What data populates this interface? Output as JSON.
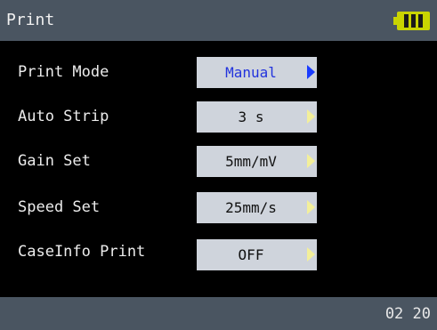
{
  "header": {
    "title": "Print",
    "battery_icon": "battery-full-icon",
    "battery_color": "#c9d400",
    "battery_level": 1.0
  },
  "settings": [
    {
      "label": "Print Mode",
      "value": "Manual",
      "active": true
    },
    {
      "label": "Auto Strip",
      "value": "3 s",
      "active": false
    },
    {
      "label": "Gain Set",
      "value": "5mm/mV",
      "active": false
    },
    {
      "label": "Speed Set",
      "value": "25mm/s",
      "active": false
    },
    {
      "label": "CaseInfo Print",
      "value": "OFF",
      "active": false
    }
  ],
  "footer": {
    "time": "02 20"
  },
  "colors": {
    "bar_background": "#4a5561",
    "screen_background": "#000000",
    "value_box": "#cfd4dc",
    "active_text": "#2233dd",
    "active_arrow": "#1a3cff",
    "inactive_arrow": "#f3ef9a"
  }
}
